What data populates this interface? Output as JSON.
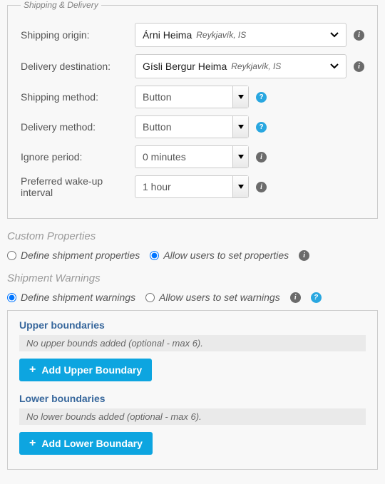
{
  "fieldset_legend": "Shipping & Delivery",
  "origin": {
    "label": "Shipping origin:",
    "name": "Árni Heima",
    "sub": "Reykjavík, IS"
  },
  "destination": {
    "label": "Delivery destination:",
    "name": "Gísli Bergur Heima",
    "sub": "Reykjavík, IS"
  },
  "shipping_method": {
    "label": "Shipping method:",
    "value": "Button"
  },
  "delivery_method": {
    "label": "Delivery method:",
    "value": "Button"
  },
  "ignore_period": {
    "label": "Ignore period:",
    "value": "0 minutes"
  },
  "wakeup": {
    "label": "Preferred wake-up interval",
    "value": "1 hour"
  },
  "custom_props": {
    "title": "Custom Properties",
    "opt_define": "Define shipment properties",
    "opt_allow": "Allow users to set properties"
  },
  "warnings": {
    "title": "Shipment Warnings",
    "opt_define": "Define shipment warnings",
    "opt_allow": "Allow users to set warnings",
    "upper_title": "Upper boundaries",
    "upper_note": "No upper bounds added (optional - max 6).",
    "add_upper": "Add Upper Boundary",
    "lower_title": "Lower boundaries",
    "lower_note": "No lower bounds added (optional - max 6).",
    "add_lower": "Add Lower Boundary"
  }
}
